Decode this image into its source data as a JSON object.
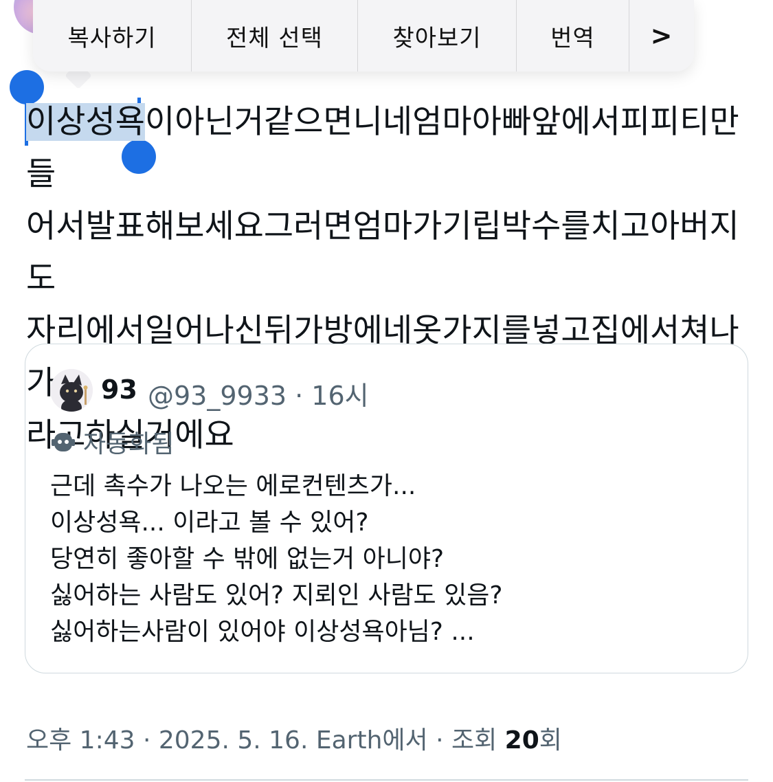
{
  "context_menu": {
    "items": [
      "복사하기",
      "전체 선택",
      "찾아보기",
      "번역"
    ],
    "more_icon": "chevron-right-icon"
  },
  "tweet": {
    "selected_text": "이상성욕",
    "line1_rest": "이아닌거같으면니네엄마아빠앞에서피피티만들",
    "line2": "어서발표해보세요그러면엄마가기립박수를치고아버지도",
    "line3": "자리에서일어나신뒤가방에네옷가지를넣고집에서쳐나가",
    "line4": "라고하실거에요"
  },
  "quote": {
    "name": "93",
    "handle_time": "@93_9933 · 16시",
    "automated_label": "자동화됨",
    "body_lines": [
      "근데 촉수가 나오는 에로컨텐츠가...",
      "이상성욕... 이라고 볼 수 있어?",
      "당연히 좋아할 수 밖에 없는거 아니야?",
      "싫어하는 사람도 있어? 지뢰인 사람도 있음?",
      "싫어하는사람이 있어야 이상성욕아님? ..."
    ]
  },
  "meta": {
    "prefix": "오후 1:43 · 2025. 5. 16. Earth에서 · 조회 ",
    "views": "20",
    "suffix": "회"
  },
  "colors": {
    "selection": "#c5d9ee",
    "handle": "#1d6fe3",
    "secondary_text": "#536471"
  }
}
